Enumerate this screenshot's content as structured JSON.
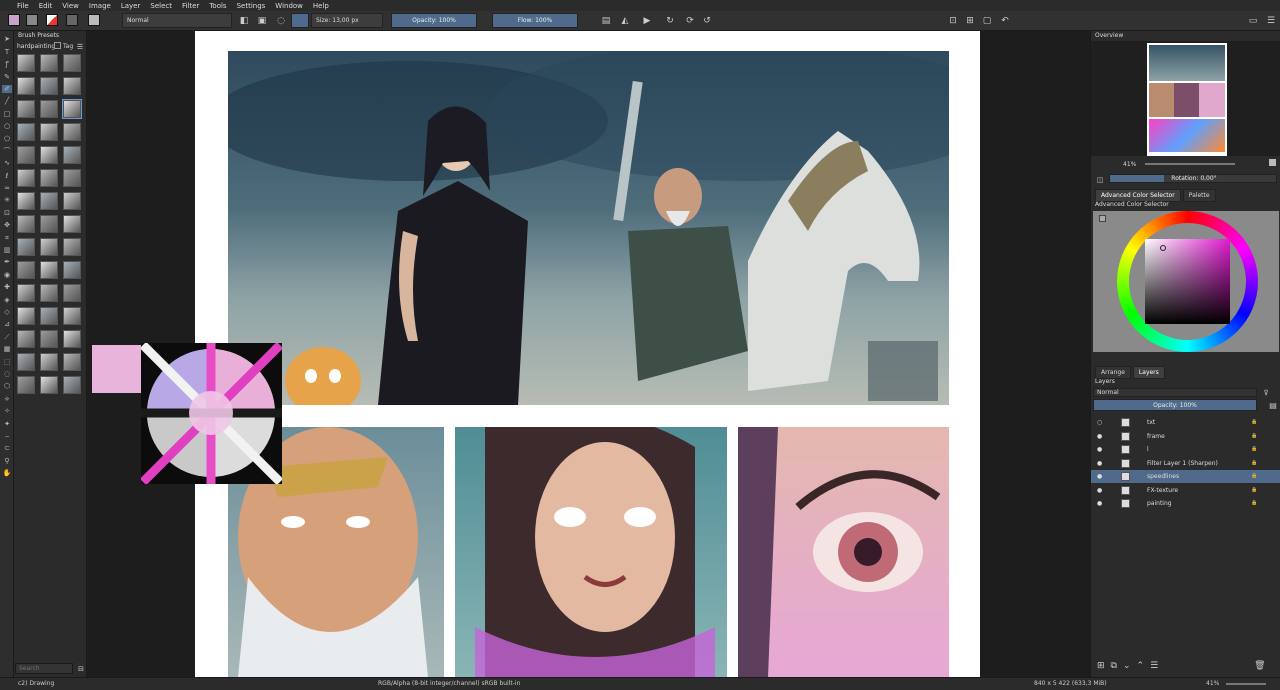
{
  "menu": [
    "File",
    "Edit",
    "View",
    "Image",
    "Layer",
    "Select",
    "Filter",
    "Tools",
    "Settings",
    "Window",
    "Help"
  ],
  "toolbar": {
    "blend_mode": "Normal",
    "size": "Size: 13,00 px",
    "opacity": "Opacity: 100%",
    "flow": "Flow: 100%"
  },
  "brush_presets": {
    "title": "Brush Presets",
    "tag_filter": "hardpainting",
    "tag_label": "Tag",
    "search_placeholder": "Search"
  },
  "overview": {
    "title": "Overview",
    "zoom": "41%",
    "rotation": "Rotation: 0,00°"
  },
  "color": {
    "tabs": [
      "Advanced Color Selector",
      "Palette"
    ],
    "title": "Advanced Color Selector",
    "foreground": "#e8a8dc"
  },
  "layers": {
    "tabs": [
      "Arrange",
      "Layers"
    ],
    "title": "Layers",
    "blend_mode": "Normal",
    "opacity": "Opacity:  100%",
    "items": [
      {
        "name": "txt",
        "visible": false
      },
      {
        "name": "frame",
        "visible": true
      },
      {
        "name": "l",
        "visible": true
      },
      {
        "name": "Filter Layer 1 (Sharpen)",
        "visible": true
      },
      {
        "name": "speedlines",
        "visible": true,
        "selected": true
      },
      {
        "name": "FX-texture",
        "visible": true
      },
      {
        "name": "painting",
        "visible": true
      }
    ]
  },
  "status": {
    "document": "c2) Drawing",
    "color_profile": "RGB/Alpha (8-bit integer/channel)  sRGB built-in",
    "dimensions": "840 x 5 422 (633,3 MiB)",
    "zoom": "41%"
  }
}
